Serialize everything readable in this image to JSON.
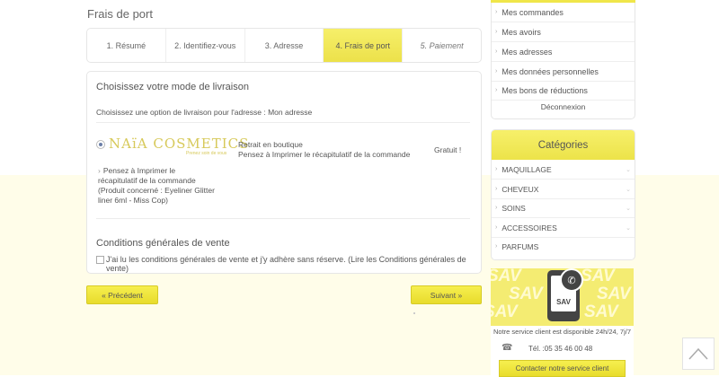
{
  "page": {
    "title": "Frais de port"
  },
  "steps": [
    {
      "label": "1. Résumé"
    },
    {
      "label": "2. Identifiez-vous"
    },
    {
      "label": "3. Adresse"
    },
    {
      "label": "4. Frais de port"
    },
    {
      "label": "5. Paiement"
    }
  ],
  "shipping": {
    "title": "Choisissez votre mode de livraison",
    "subtitle": "Choisissez une option de livraison pour l'adresse : Mon adresse",
    "carrier": {
      "logo_text": "NAïA COSMETICS",
      "logo_sub": "Prenez soin de vous",
      "description": "Pensez à Imprimer le récapitulatif de la commande (Produit concerné : Eyeliner Glitter liner 6ml - Miss Cop)",
      "name": "Retrait en boutique",
      "delay": "Pensez à Imprimer le récapitulatif de la commande",
      "price": "Gratuit !"
    },
    "cgv_title": "Conditions générales de vente",
    "cgv_label": "J'ai lu les conditions générales de vente et j'y adhère sans réserve. (Lire les Conditions générales de vente)"
  },
  "nav": {
    "prev": "« Précédent",
    "next": "Suivant »"
  },
  "account": {
    "items": [
      "Mes commandes",
      "Mes avoirs",
      "Mes adresses",
      "Mes données personnelles",
      "Mes bons de réductions"
    ],
    "logout": "Déconnexion"
  },
  "categories": {
    "title": "Catégories",
    "items": [
      "MAQUILLAGE",
      "CHEVEUX",
      "SOINS",
      "ACCESSOIRES",
      "PARFUMS"
    ]
  },
  "sav": {
    "banner_word": "SAV",
    "phone_label": "SAV",
    "availability": "Notre service client est disponible 24h/24, 7j/7",
    "tel": "Tél. :05 35 46 00 48",
    "contact_button": "Contacter notre service client"
  },
  "icons": {
    "back_to_top": "chevron-up-icon",
    "phone": "phone-icon",
    "radio": "radio-selected"
  },
  "colors": {
    "accent": "#f0e64a",
    "background_lower": "#fffde9"
  }
}
